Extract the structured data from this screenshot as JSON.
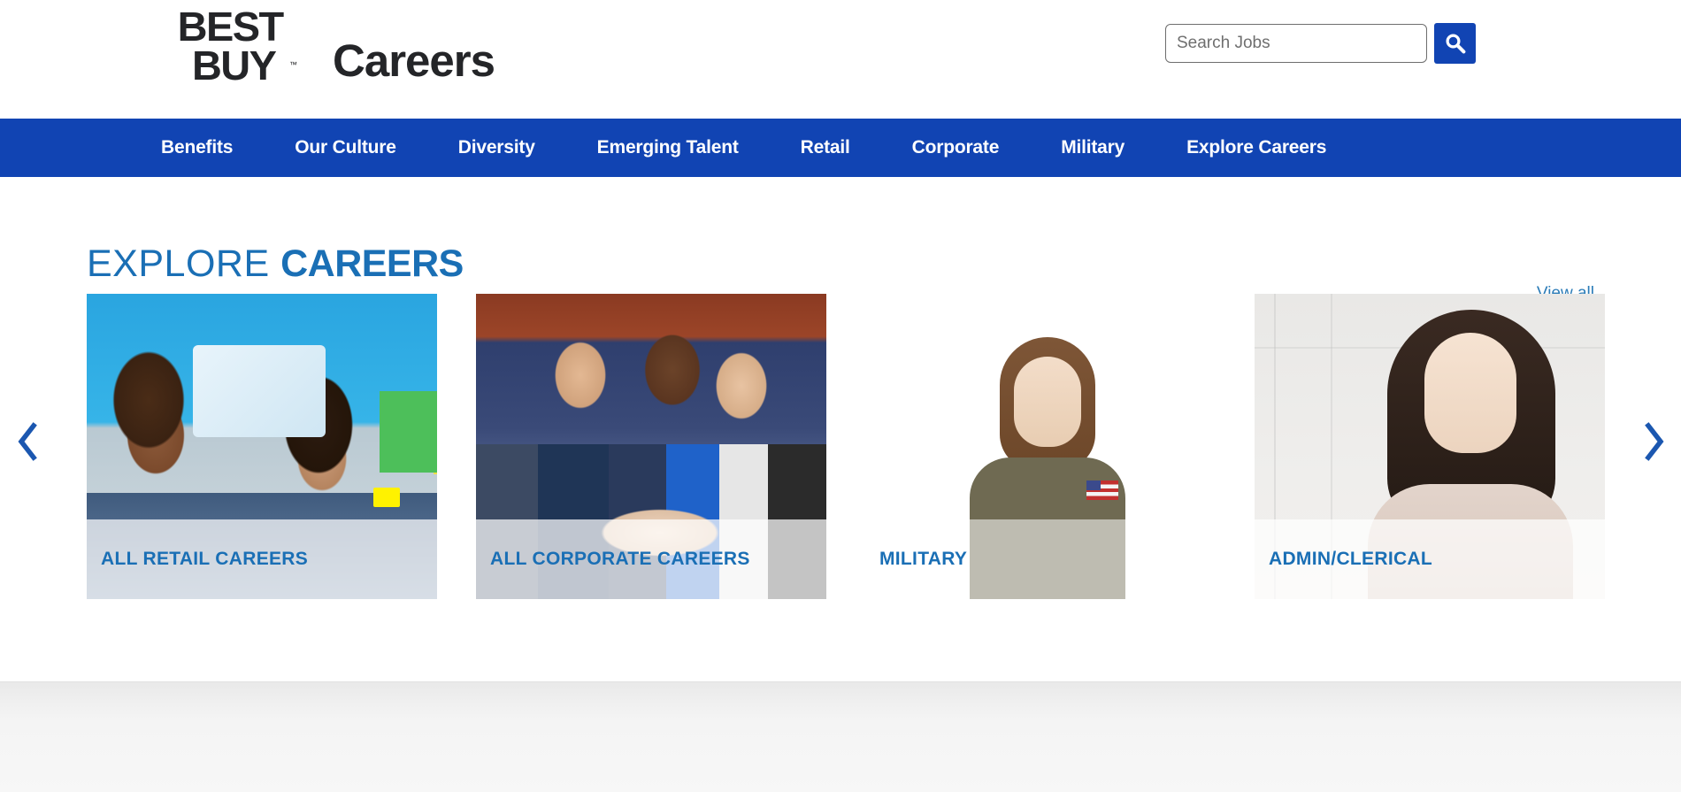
{
  "site": {
    "brand_line1": "BEST",
    "brand_line2": "BUY",
    "brand_tm": "™",
    "brand_suffix": "Careers",
    "brand_dark": "#242528",
    "brand_yellow": "#FFF200",
    "brand_blue": "#1144b3",
    "accent_blue": "#1a6fb5"
  },
  "search": {
    "placeholder": "Search Jobs",
    "value": "",
    "button_icon": "search-icon",
    "button_label": "Search"
  },
  "nav": {
    "items": [
      {
        "label": "Benefits"
      },
      {
        "label": "Our Culture"
      },
      {
        "label": "Diversity"
      },
      {
        "label": "Emerging Talent"
      },
      {
        "label": "Retail"
      },
      {
        "label": "Corporate"
      },
      {
        "label": "Military"
      },
      {
        "label": "Explore Careers"
      }
    ]
  },
  "explore": {
    "title_light": "EXPLORE",
    "title_bold": "CAREERS",
    "view_all": "View all",
    "prev_icon": "chevron-left-icon",
    "next_icon": "chevron-right-icon",
    "cards": [
      {
        "caption": "ALL RETAIL CAREERS",
        "image_alt": "two-retail-employees-at-checkout"
      },
      {
        "caption": "ALL CORPORATE CAREERS",
        "image_alt": "corporate-team-celebrating"
      },
      {
        "caption": "MILITARY",
        "image_alt": "soldier-in-camouflage-uniform"
      },
      {
        "caption": "ADMIN/CLERICAL",
        "image_alt": "office-professional-portrait"
      }
    ]
  }
}
